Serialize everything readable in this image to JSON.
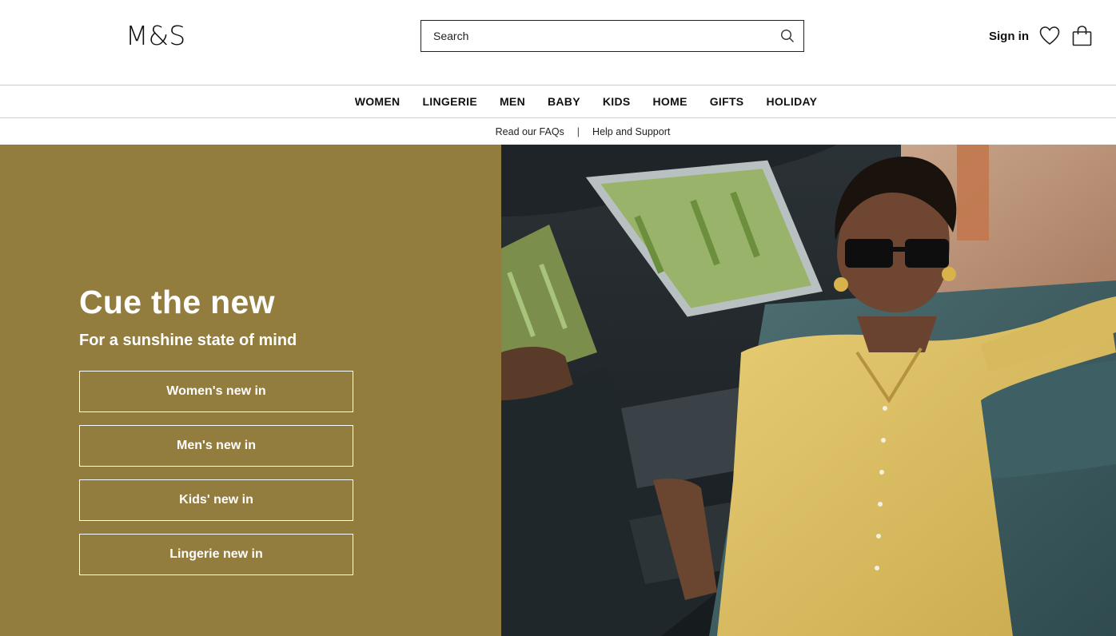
{
  "header": {
    "logo": "M&S",
    "search_placeholder": "Search",
    "sign_in": "Sign in",
    "icons": [
      "search-icon",
      "heart-icon",
      "shopping-bag-icon"
    ]
  },
  "nav": {
    "items": [
      "WOMEN",
      "LINGERIE",
      "MEN",
      "BABY",
      "KIDS",
      "HOME",
      "GIFTS",
      "HOLIDAY"
    ]
  },
  "subnav": {
    "faqs": "Read our FAQs",
    "separator": "|",
    "help": "Help and Support"
  },
  "hero": {
    "title": "Cue the new",
    "subtitle": "For a sunshine state of mind",
    "buttons": [
      "Women's new in",
      "Men's new in",
      "Kids' new in",
      "Lingerie new in"
    ],
    "background_color": "#927c3e"
  }
}
